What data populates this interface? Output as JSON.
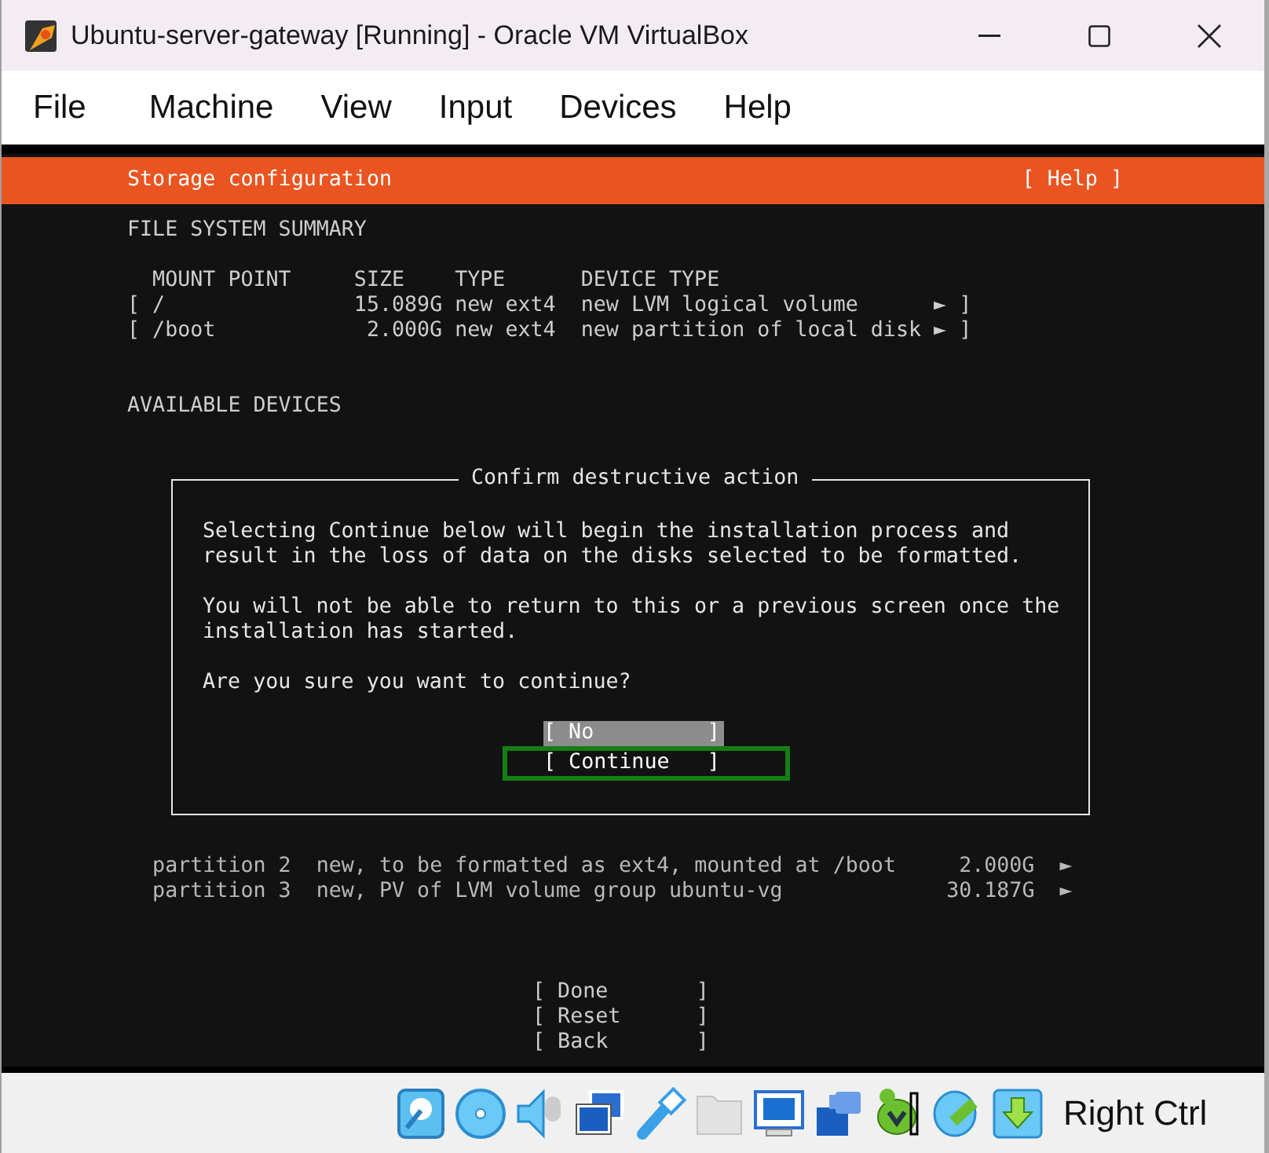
{
  "window": {
    "title": "Ubuntu-server-gateway [Running] - Oracle VM VirtualBox"
  },
  "menu": [
    "File",
    "Machine",
    "View",
    "Input",
    "Devices",
    "Help"
  ],
  "installer": {
    "title": "Storage configuration",
    "help": "[ Help ]",
    "summary_heading": "FILE SYSTEM SUMMARY",
    "columns": [
      "MOUNT POINT",
      "SIZE",
      "TYPE",
      "DEVICE TYPE"
    ],
    "filesystems": [
      {
        "open": "[",
        "mount": "/",
        "size": "15.089G",
        "type": "new ext4",
        "device_type": "new LVM logical volume",
        "arrow": "►",
        "close": "]"
      },
      {
        "open": "[",
        "mount": "/boot",
        "size": "2.000G",
        "type": "new ext4",
        "device_type": "new partition of local disk",
        "arrow": "►",
        "close": "]"
      }
    ],
    "devices_heading": "AVAILABLE DEVICES",
    "partitions": [
      {
        "name": "partition 2",
        "description": "new, to be formatted as ext4, mounted at /boot",
        "size": "2.000G",
        "arrow": "►"
      },
      {
        "name": "partition 3",
        "description": "new, PV of LVM volume group ubuntu-vg",
        "size": "30.187G",
        "arrow": "►"
      }
    ],
    "buttons": [
      {
        "label": "[ Done       ]"
      },
      {
        "label": "[ Reset      ]"
      },
      {
        "label": "[ Back       ]"
      }
    ]
  },
  "dialog": {
    "title": "Confirm destructive action",
    "paragraphs": [
      "Selecting Continue below will begin the installation process and result in the loss of data on the disks selected to be formatted.",
      "You will not be able to return to this or a previous screen once the installation has started.",
      "Are you sure you want to continue?"
    ],
    "buttons": [
      {
        "label": "[ No         ]",
        "selected": true,
        "outlined": false
      },
      {
        "label": "[ Continue   ]",
        "selected": false,
        "outlined": true
      }
    ]
  },
  "status_bar": {
    "host_key": "Right Ctrl"
  }
}
